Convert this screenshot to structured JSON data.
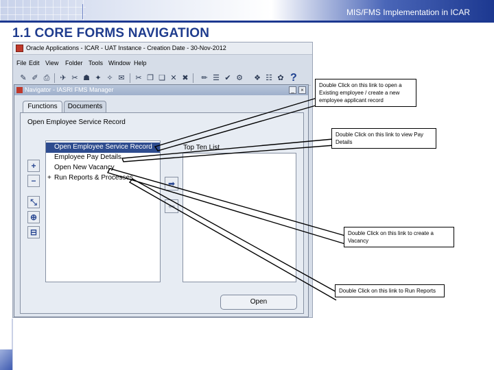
{
  "header": {
    "caption": "MIS/FMS Implementation in ICAR"
  },
  "slide": {
    "title": "1.1 CORE  FORMS NAVIGATION"
  },
  "oracle": {
    "window_title": "Oracle Applications - ICAR - UAT Instance - Creation Date - 30-Nov-2012",
    "menu": [
      "File",
      "Edit",
      "View",
      "Folder",
      "Tools",
      "Window",
      "Help"
    ],
    "toolbar_icons": [
      "open-icon",
      "save-icon",
      "print-icon",
      "navigate-icon",
      "zoom-icon",
      "find-icon",
      "find-all-icon",
      "attachments-icon",
      "folder-icon",
      "cut-icon",
      "copy-icon",
      "paste-icon",
      "clear-icon",
      "delete-icon",
      "edit-icon",
      "translate-icon",
      "spell-icon",
      "tools-icon"
    ],
    "help_icon": "?"
  },
  "navigator": {
    "title": "Navigator - IASRI FMS Manager",
    "tabs": [
      "Functions",
      "Documents"
    ],
    "selected_path": "Open Employee Service Record",
    "items": [
      {
        "label": "Open Employee Service Record",
        "selected": true,
        "prefix": ""
      },
      {
        "label": "Employee Pay Details",
        "selected": false,
        "prefix": ""
      },
      {
        "label": "Open New Vacancy",
        "selected": false,
        "prefix": ""
      },
      {
        "label": "Run Reports & Processes",
        "selected": false,
        "prefix": "+"
      }
    ],
    "side_buttons": {
      "expand": "+",
      "collapse": "−",
      "expand_branch": "⤡",
      "expand_all": "⊕",
      "collapse_all": "⊟"
    },
    "add_button": "➡",
    "remove_button": "⬅",
    "top_ten_label": "Top Ten List",
    "open_button": "Open",
    "window_buttons": {
      "minimize": "_",
      "close": "×"
    }
  },
  "callouts": [
    {
      "text": "Double Click on this link to open a Existing employee / create a new employee applicant record"
    },
    {
      "text": "Double Click on this link to view Pay Details"
    },
    {
      "text": "Double Click on this link to create a Vacancy"
    },
    {
      "text": "Double Click on this link to Run Reports"
    }
  ]
}
